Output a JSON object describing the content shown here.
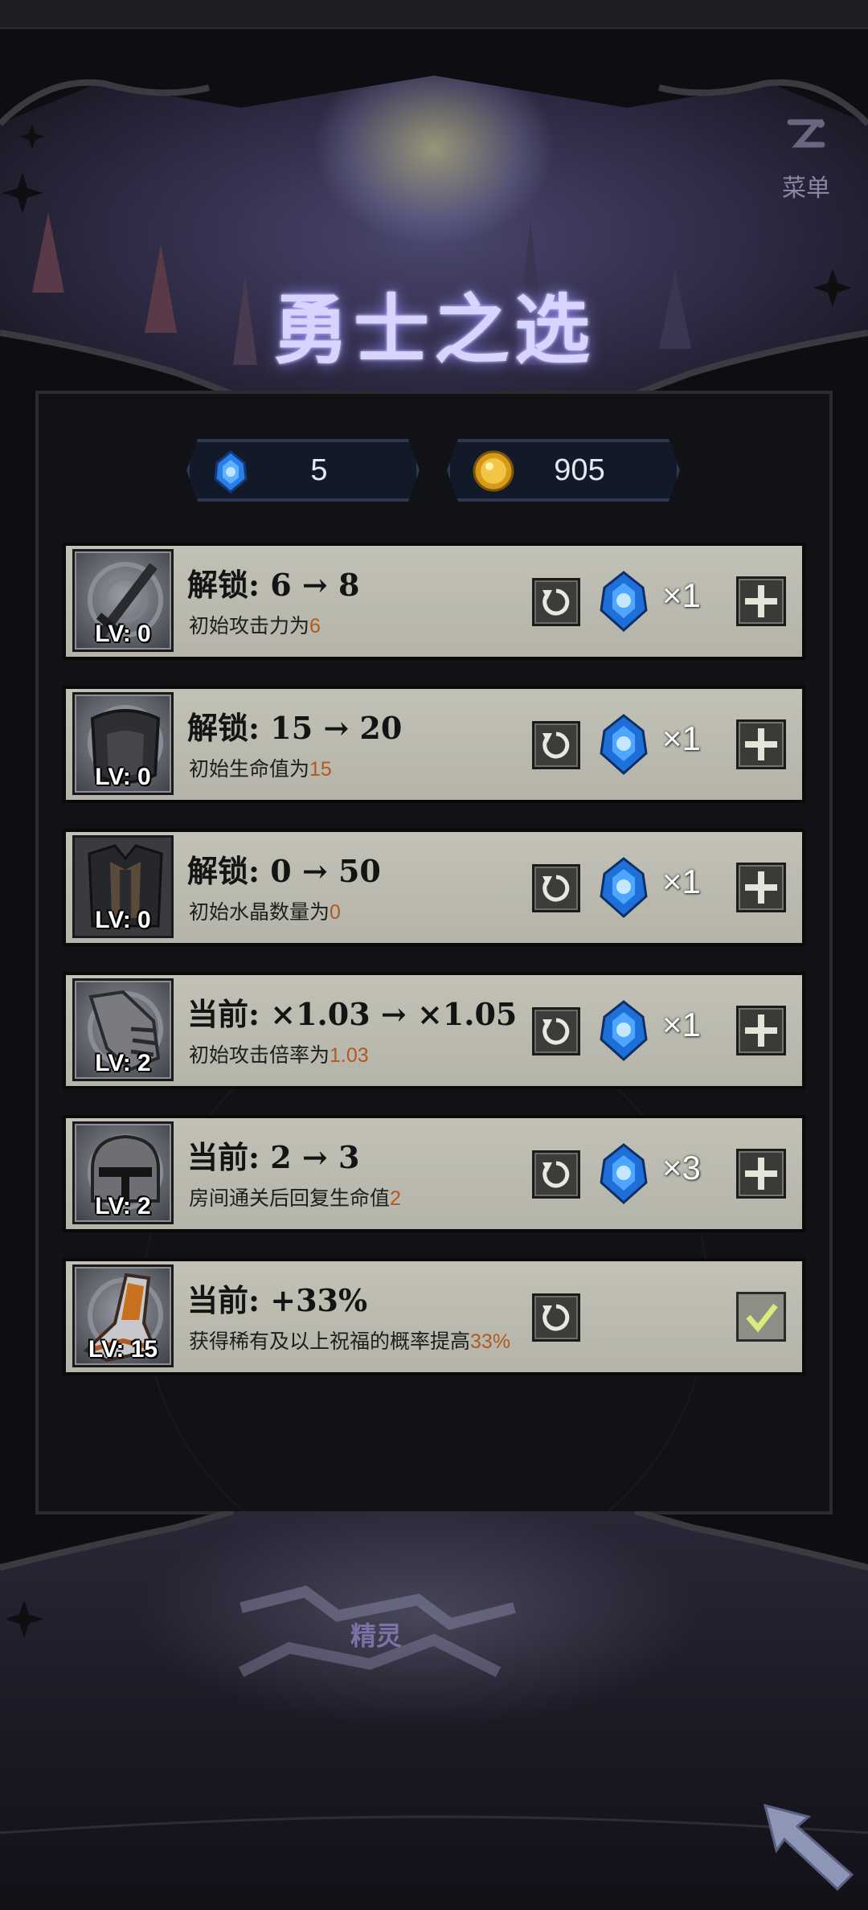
{
  "header": {
    "title": "勇士之选",
    "menu_label": "菜单"
  },
  "currency": {
    "crystal": "5",
    "gold": "905"
  },
  "rows": [
    {
      "icon": "sword-icon",
      "level": "LV: 0",
      "title": "解锁: 6 → 8",
      "desc": "初始攻击力为",
      "highlight": "6",
      "cost": "×1",
      "action": "plus"
    },
    {
      "icon": "breastplate-icon",
      "level": "LV: 0",
      "title": "解锁: 15 → 20",
      "desc": "初始生命值为",
      "highlight": "15",
      "cost": "×1",
      "action": "plus"
    },
    {
      "icon": "armor-icon",
      "level": "LV: 0",
      "title": "解锁: 0 → 50",
      "desc": "初始水晶数量为",
      "highlight": "0",
      "cost": "×1",
      "action": "plus"
    },
    {
      "icon": "gauntlet-icon",
      "level": "LV: 2",
      "title": "当前: ×1.03 → ×1.05",
      "desc": "初始攻击倍率为",
      "highlight": "1.03",
      "cost": "×1",
      "action": "plus"
    },
    {
      "icon": "helmet-icon",
      "level": "LV: 2",
      "title": "当前: 2 → 3",
      "desc": "房间通关后回复生命值",
      "highlight": "2",
      "cost": "×3",
      "action": "plus"
    },
    {
      "icon": "boot-icon",
      "level": "LV: 15",
      "title": "当前: +33%",
      "desc": "获得稀有及以上祝福的概率提高",
      "highlight": "33%",
      "cost": "",
      "action": "check"
    }
  ],
  "footer": {
    "spirit_label": "精灵"
  },
  "colors": {
    "highlight": "#b05a22",
    "title_glow": "#d8d4ff",
    "row_bg": "#c2c1b6"
  }
}
